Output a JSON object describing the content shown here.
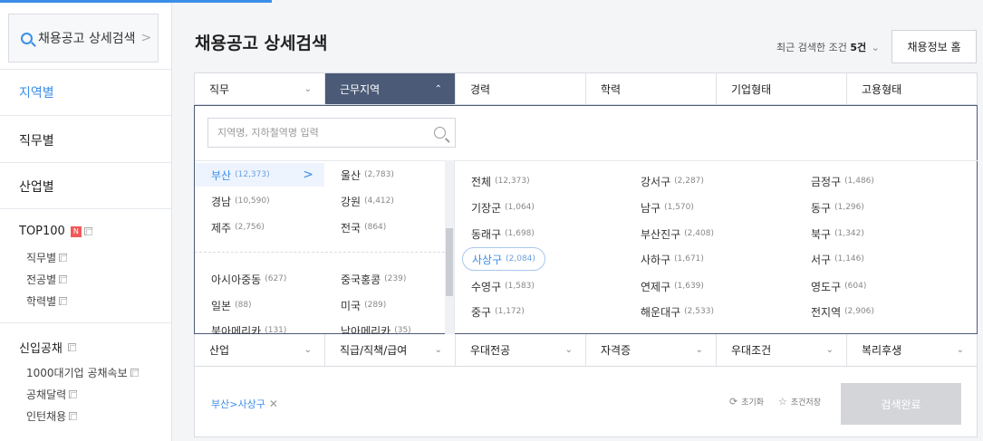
{
  "sidebar": {
    "search_label": "채용공고 상세검색",
    "items": [
      {
        "label": "지역별"
      },
      {
        "label": "직무별"
      },
      {
        "label": "산업별"
      }
    ],
    "top100": {
      "label": "TOP100",
      "badge": "N",
      "subs": [
        "직무별",
        "전공별",
        "학력별"
      ]
    },
    "newgrad": {
      "label": "신입공채",
      "subs": [
        "1000대기업 공채속보",
        "공채달력",
        "인턴채용"
      ]
    }
  },
  "header": {
    "title": "채용공고 상세검색",
    "recent_prefix": "최근 검색한 조건",
    "recent_count": "5건",
    "home_button": "채용정보 홈"
  },
  "tabs": [
    "직무",
    "근무지역",
    "경력",
    "학력",
    "기업형태",
    "고용형태"
  ],
  "active_tab": "근무지역",
  "search": {
    "placeholder": "지역명, 지하철역명 입력"
  },
  "regions": [
    {
      "name": "부산",
      "count": "(12,373)"
    },
    {
      "name": "울산",
      "count": "(2,783)"
    },
    {
      "name": "경남",
      "count": "(10,590)"
    },
    {
      "name": "강원",
      "count": "(4,412)"
    },
    {
      "name": "제주",
      "count": "(2,756)"
    },
    {
      "name": "전국",
      "count": "(864)"
    },
    {
      "name": "아시아중동",
      "count": "(627)"
    },
    {
      "name": "중국홍콩",
      "count": "(239)"
    },
    {
      "name": "일본",
      "count": "(88)"
    },
    {
      "name": "미국",
      "count": "(289)"
    },
    {
      "name": "북아메리카",
      "count": "(131)"
    },
    {
      "name": "남아메리카",
      "count": "(35)"
    }
  ],
  "districts": [
    {
      "name": "전체",
      "count": "(12,373)"
    },
    {
      "name": "강서구",
      "count": "(2,287)"
    },
    {
      "name": "금정구",
      "count": "(1,486)"
    },
    {
      "name": "기장군",
      "count": "(1,064)"
    },
    {
      "name": "남구",
      "count": "(1,570)"
    },
    {
      "name": "동구",
      "count": "(1,296)"
    },
    {
      "name": "동래구",
      "count": "(1,698)"
    },
    {
      "name": "부산진구",
      "count": "(2,408)"
    },
    {
      "name": "북구",
      "count": "(1,342)"
    },
    {
      "name": "사상구",
      "count": "(2,084)"
    },
    {
      "name": "사하구",
      "count": "(1,671)"
    },
    {
      "name": "서구",
      "count": "(1,146)"
    },
    {
      "name": "수영구",
      "count": "(1,583)"
    },
    {
      "name": "연제구",
      "count": "(1,639)"
    },
    {
      "name": "영도구",
      "count": "(604)"
    },
    {
      "name": "중구",
      "count": "(1,172)"
    },
    {
      "name": "해운대구",
      "count": "(2,533)"
    },
    {
      "name": "전지역",
      "count": "(2,906)"
    }
  ],
  "tabs2": [
    "산업",
    "직급/직책/급여",
    "우대전공",
    "자격증",
    "우대조건",
    "복리후생"
  ],
  "selected": {
    "chip": "부산>사상구"
  },
  "actions": {
    "reset": "초기화",
    "save": "조건저장",
    "done": "검색완료"
  },
  "colors": {
    "accent": "#3b8ee8",
    "active_tab": "#4b5a76",
    "done_disabled": "#d3d5d9"
  }
}
